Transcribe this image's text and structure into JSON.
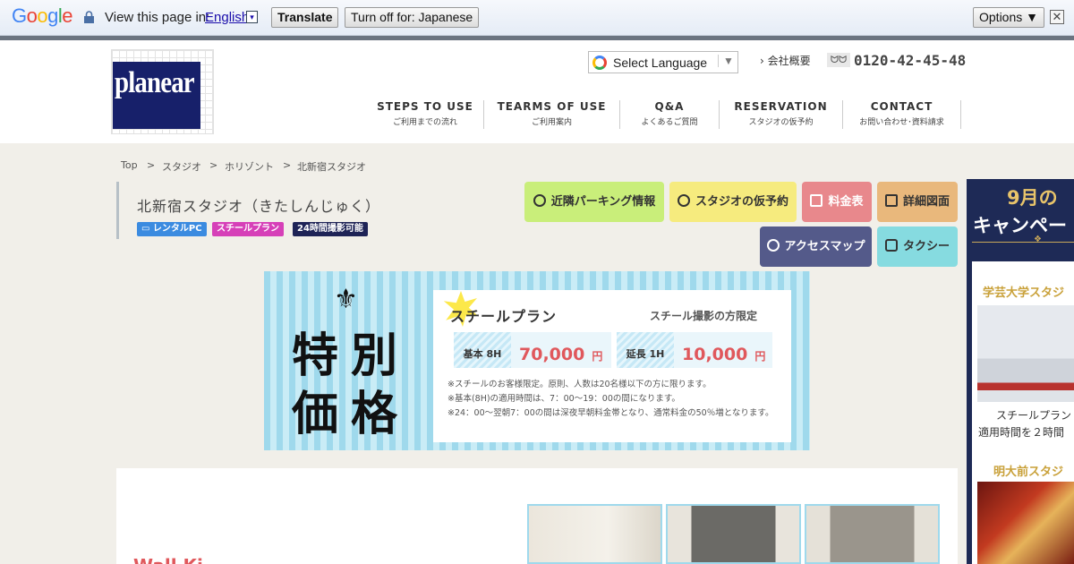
{
  "translate_bar": {
    "logo": "Google",
    "view_text": "View this page in:",
    "language": "English",
    "lang_arrow": "▾",
    "translate_btn": "Translate",
    "turn_off_btn": "Turn off for: Japanese",
    "options_btn": "Options ▼",
    "close": "✕"
  },
  "header": {
    "logo_text": "planear",
    "select_language": "Select Language",
    "select_arrow": "▼",
    "company_link": "› 会社概要",
    "phone_icon": "ᗢᗢ",
    "phone": "0120-42-45-48",
    "nav": [
      {
        "en": "STEPS TO USE",
        "jp": "ご利用までの流れ"
      },
      {
        "en": "TEARMS OF USE",
        "jp": "ご利用案内"
      },
      {
        "en": "Q&A",
        "jp": "よくあるご質問"
      },
      {
        "en": "RESERVATION",
        "jp": "スタジオの仮予約"
      },
      {
        "en": "CONTACT",
        "jp": "お問い合わせ･資料請求"
      }
    ]
  },
  "breadcrumb": [
    "Top",
    ">",
    "スタジオ",
    ">",
    "ホリゾント",
    ">",
    "北新宿スタジオ"
  ],
  "page": {
    "title": "北新宿スタジオ（きたしんじゅく）",
    "tags": [
      "▭ レンタルPC",
      "スチールプラン",
      "24時間撮影可能"
    ]
  },
  "actions": [
    {
      "label": "近隣パーキング情報",
      "icon": "parking-icon"
    },
    {
      "label": "スタジオの仮予約",
      "icon": "clock-icon"
    },
    {
      "label": "料金表",
      "icon": "calculator-icon"
    },
    {
      "label": "詳細図面",
      "icon": "floorplan-icon"
    },
    {
      "label": "アクセスマップ",
      "icon": "map-pin-icon"
    },
    {
      "label": "タクシー",
      "icon": "taxi-icon"
    }
  ],
  "campaign": {
    "fleur": "⚜",
    "big_line1": "特別",
    "big_line2": "価格",
    "plan_name": "スチールプラン",
    "plan_note": "スチール撮影の方限定",
    "price1_label": "基本 8H",
    "price1_value": "70,000",
    "price2_label": "延長 1H",
    "price2_value": "10,000",
    "yen": "円",
    "notes": [
      "※スチールのお客様限定。原則、人数は20名様以下の方に限ります。",
      "※基本(8H)の適用時間は、7：00〜19：00の間になります。",
      "※24：00〜翌朝7：00の間は深夜早朝料金帯となり、通常料金の50％増となります。"
    ]
  },
  "content": {
    "heading": "Wall Ki"
  },
  "side": {
    "title_line1": "9月の",
    "title_line2": "キャンペー",
    "ornament": "❖",
    "studio1_heading": "学芸大学スタジ",
    "studio1_text1": "スチールプラン",
    "studio1_text2": "適用時間を２時間",
    "studio2_heading": "明大前スタジ"
  }
}
